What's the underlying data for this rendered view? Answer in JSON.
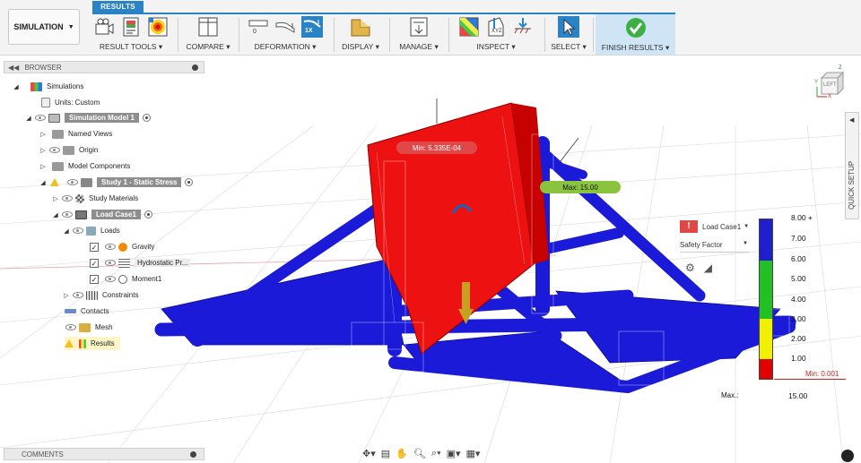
{
  "toolbar": {
    "workspace": "SIMULATION",
    "active_tab": "RESULTS",
    "groups": [
      {
        "label": "RESULT TOOLS"
      },
      {
        "label": "COMPARE"
      },
      {
        "label": "DEFORMATION"
      },
      {
        "label": "DISPLAY"
      },
      {
        "label": "MANAGE"
      },
      {
        "label": "INSPECT"
      },
      {
        "label": "SELECT"
      },
      {
        "label": "FINISH RESULTS"
      }
    ],
    "deformation_scale_label": "1X",
    "deformation_zero_label": "0",
    "inspect_xyz_label": "XYZ"
  },
  "browser": {
    "title": "BROWSER",
    "items": [
      {
        "label": "Simulations"
      },
      {
        "label": "Units: Custom"
      },
      {
        "label": "Simulation Model 1"
      },
      {
        "label": "Named Views"
      },
      {
        "label": "Origin"
      },
      {
        "label": "Model Components"
      },
      {
        "label": "Study 1 - Static Stress"
      },
      {
        "label": "Study Materials"
      },
      {
        "label": "Load Case1"
      },
      {
        "label": "Loads"
      },
      {
        "label": "Gravity"
      },
      {
        "label": "Hydrostatic Pr..."
      },
      {
        "label": "Moment1"
      },
      {
        "label": "Constraints"
      },
      {
        "label": "Contacts"
      },
      {
        "label": "Mesh"
      },
      {
        "label": "Results"
      }
    ]
  },
  "comments": {
    "title": "COMMENTS"
  },
  "quick_setup": {
    "label": "QUICK SETUP"
  },
  "callouts": {
    "min": "Min: 5.335E-04",
    "max": "Max: 15.00"
  },
  "legend": {
    "load_case": "Load Case1",
    "result_type": "Safety Factor",
    "ticks": [
      "8.00 +",
      "7.00",
      "6.00",
      "5.00",
      "4.00",
      "3.00",
      "2.00",
      "1.00"
    ],
    "min_label": "Min: 0.001",
    "max_label": "Max.:",
    "max_value": "15.00",
    "colors": {
      "blue": "#1f1fd0",
      "green": "#22c022",
      "yellow": "#f0f000",
      "red": "#e00000"
    }
  },
  "viewcube": {
    "face_label": "LEFT",
    "axis_x": "X",
    "axis_y": "Y",
    "axis_z": "Z"
  },
  "colors": {
    "accent": "#2a83c5",
    "stress_red": "#ee1111",
    "frame_blue": "#1a1ad8",
    "finish_green": "#3cb043"
  }
}
